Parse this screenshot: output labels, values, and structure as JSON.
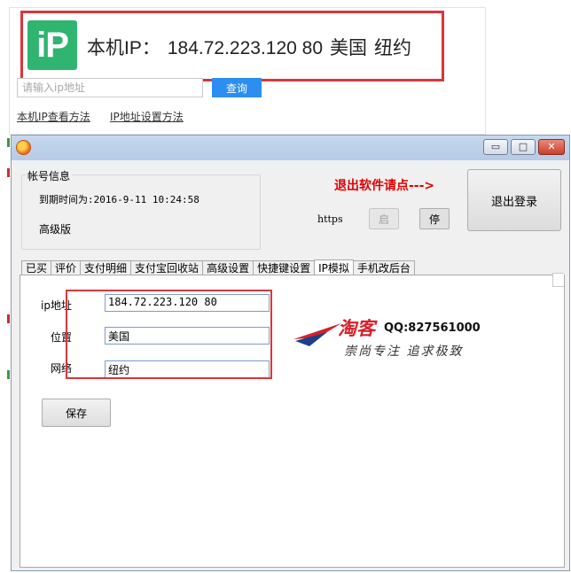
{
  "web": {
    "logo_text": "iP",
    "ip_label": "本机IP：",
    "ip_value": "184.72.223.120 80",
    "country": "美国",
    "city": "纽约",
    "search_placeholder": "请输入ip地址",
    "search_button": "查询",
    "links": [
      "本机IP查看方法",
      "IP地址设置方法"
    ]
  },
  "app": {
    "window_buttons": {
      "minimize": "▭",
      "maximize": "□",
      "close": "✕"
    },
    "account": {
      "group_title": "帐号信息",
      "expire_text": "到期时间为:2016-9-11 10:24:58",
      "edition": "高级版"
    },
    "exit_hint": "退出软件请点--->",
    "https_label": "https",
    "start_button": "启",
    "stop_button": "停",
    "logout_button": "退出登录",
    "tabs": [
      {
        "label": "已买",
        "active": false
      },
      {
        "label": "评价",
        "active": false
      },
      {
        "label": "支付明细",
        "active": false
      },
      {
        "label": "支付宝回收站",
        "active": false
      },
      {
        "label": "高级设置",
        "active": false
      },
      {
        "label": "快捷键设置",
        "active": false
      },
      {
        "label": "IP模拟",
        "active": true
      },
      {
        "label": "手机改后台",
        "active": false
      }
    ],
    "ip_form": {
      "ip_label": "ip地址",
      "ip_value": "184.72.223.120 80",
      "location_label": "位置",
      "location_value": "美国",
      "network_label": "网络",
      "network_value": "纽约",
      "save_button": "保存"
    },
    "watermark": {
      "brand": "淘客",
      "qq": "QQ:827561000",
      "slogan": "崇尚专注 追求极致"
    }
  },
  "colors": {
    "highlight": "#d8363c",
    "logo_green": "#2fb56f",
    "search_button": "#2c8ef0",
    "hint_red": "#e00000"
  }
}
